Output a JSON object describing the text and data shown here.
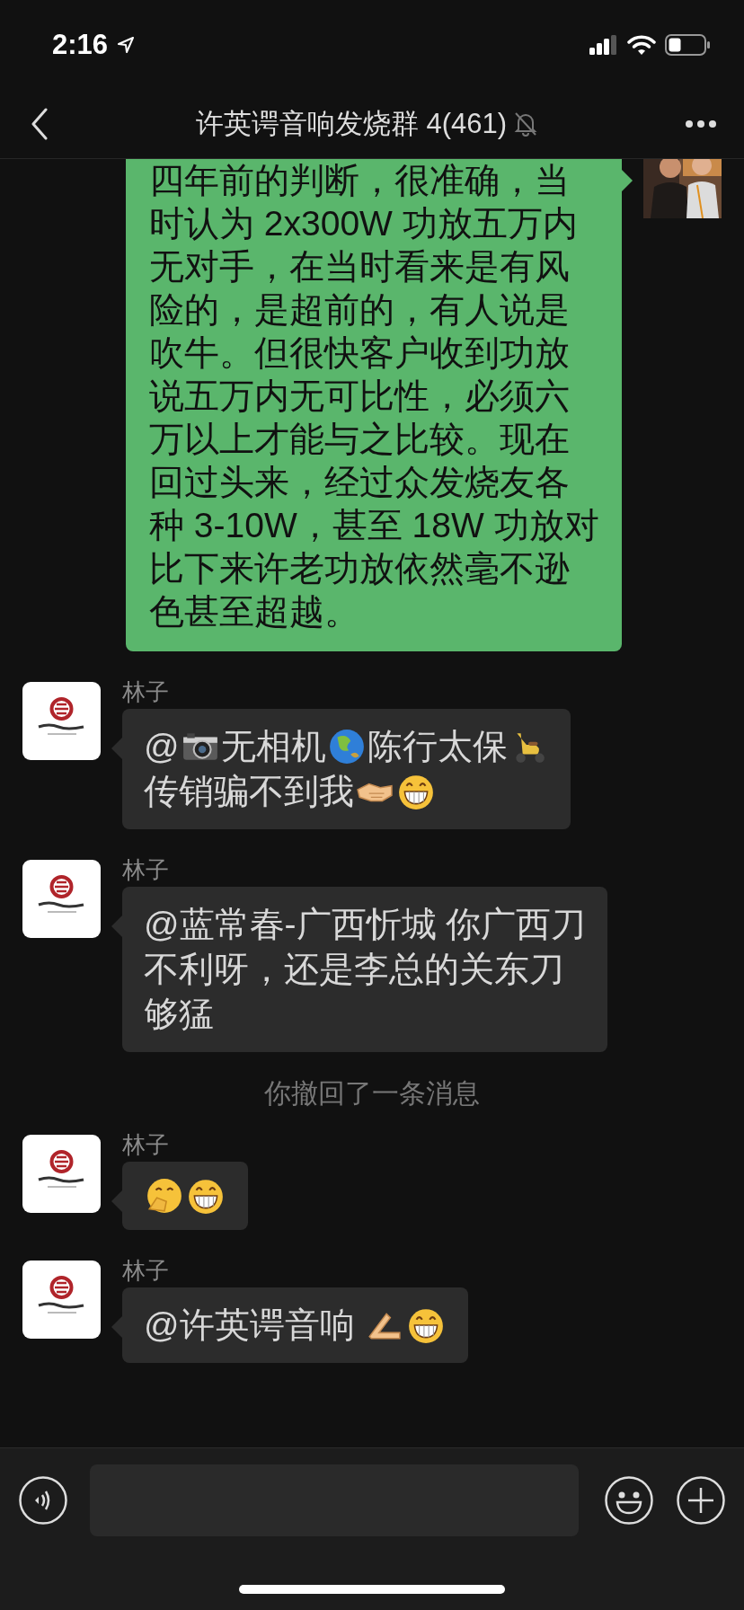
{
  "status_bar": {
    "time": "2:16"
  },
  "nav": {
    "title": "许英谔音响发烧群 4(461)",
    "muted": true
  },
  "messages": [
    {
      "kind": "outgoing",
      "lines": [
        [
          {
            "kind": "text",
            "text": "四年前的判断，很准确，当"
          }
        ],
        [
          {
            "kind": "text",
            "text": "时认为 2x300W 功放五万内"
          }
        ],
        [
          {
            "kind": "text",
            "text": "无对手，在当时看来是有风"
          }
        ],
        [
          {
            "kind": "text",
            "text": "险的，是超前的，有人说是"
          }
        ],
        [
          {
            "kind": "text",
            "text": "吹牛。但很快客户收到功放"
          }
        ],
        [
          {
            "kind": "text",
            "text": "说五万内无可比性，必须六"
          }
        ],
        [
          {
            "kind": "text",
            "text": "万以上才能与之比较。现在"
          }
        ],
        [
          {
            "kind": "text",
            "text": "回过头来，经过众发烧友各"
          }
        ],
        [
          {
            "kind": "text",
            "text": "种 3-10W，甚至 18W 功放对"
          }
        ],
        [
          {
            "kind": "text",
            "text": "比下来许老功放依然毫不逊"
          }
        ],
        [
          {
            "kind": "text",
            "text": "色甚至超越。"
          }
        ]
      ]
    },
    {
      "kind": "incoming",
      "sender": "林子",
      "lines": [
        [
          {
            "kind": "text",
            "text": "@"
          },
          {
            "kind": "camera"
          },
          {
            "kind": "text",
            "text": "无相机"
          },
          {
            "kind": "globe"
          },
          {
            "kind": "text",
            "text": "陈行太保"
          },
          {
            "kind": "scooter"
          }
        ],
        [
          {
            "kind": "text",
            "text": "传销骗不到我"
          },
          {
            "kind": "handshake"
          },
          {
            "kind": "grin"
          }
        ]
      ]
    },
    {
      "kind": "incoming",
      "sender": "林子",
      "lines": [
        [
          {
            "kind": "text",
            "text": "@蓝常春-广西忻城 你广西刀"
          }
        ],
        [
          {
            "kind": "text",
            "text": "不利呀，还是李总的关东刀"
          }
        ],
        [
          {
            "kind": "text",
            "text": "够猛"
          }
        ]
      ]
    },
    {
      "kind": "system",
      "text": "你撤回了一条消息"
    },
    {
      "kind": "incoming",
      "sender": "林子",
      "lines": [
        [
          {
            "kind": "hand-over-mouth"
          },
          {
            "kind": "grin"
          }
        ]
      ]
    },
    {
      "kind": "incoming",
      "sender": "林子",
      "lines": [
        [
          {
            "kind": "text",
            "text": "@许英谔音响 "
          },
          {
            "kind": "hands"
          },
          {
            "kind": "grin"
          }
        ]
      ]
    }
  ]
}
